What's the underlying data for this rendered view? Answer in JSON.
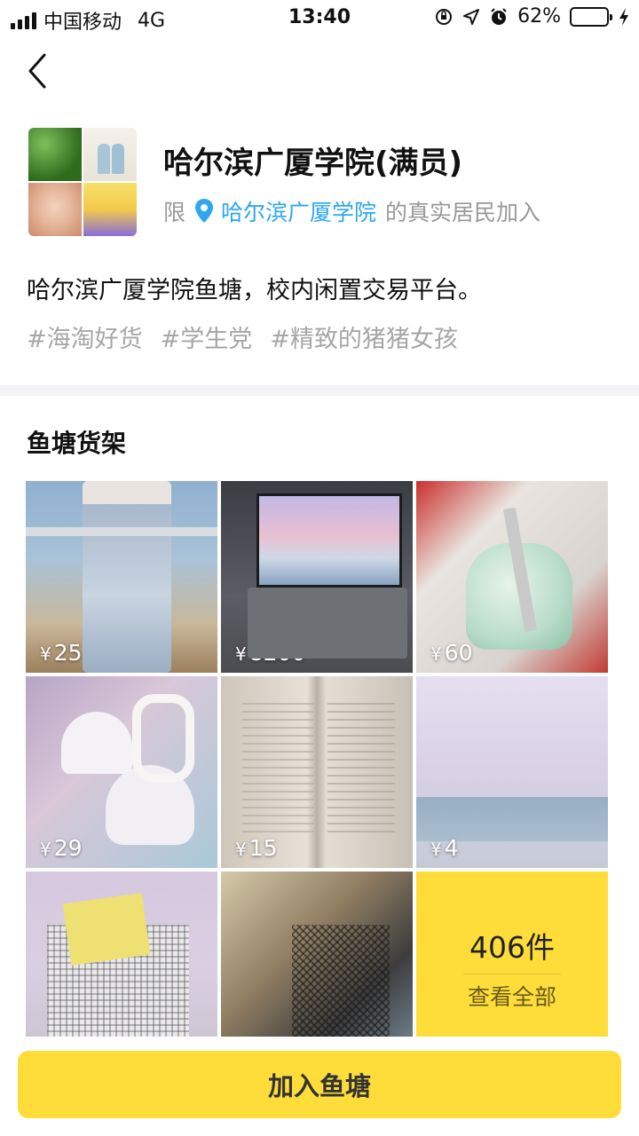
{
  "status_bar": {
    "carrier": "中国移动",
    "network": "4G",
    "time": "13:40",
    "battery_percent": "62%",
    "battery_level": 0.62,
    "icons": [
      "signal-icon",
      "orientation-lock-icon",
      "location-arrow-icon",
      "alarm-icon",
      "battery-icon",
      "charging-icon"
    ]
  },
  "nav": {
    "back_icon": "chevron-left-icon"
  },
  "pond": {
    "name": "哈尔滨广厦学院(满员)",
    "limit_prefix": "限",
    "limit_place": "哈尔滨广厦学院",
    "limit_suffix": "的真实居民加入",
    "description": "哈尔滨广厦学院鱼塘，校内闲置交易平台。",
    "tags": [
      "#海淘好货",
      "#学生党",
      "#精致的猪猪女孩"
    ]
  },
  "shelf": {
    "title": "鱼塘货架",
    "currency": "¥",
    "items": [
      {
        "price": "25",
        "image": "jeans"
      },
      {
        "price": "8200",
        "image": "laptop"
      },
      {
        "price": "60",
        "image": "heels"
      },
      {
        "price": "29",
        "image": "lamp"
      },
      {
        "price": "15",
        "image": "book"
      },
      {
        "price": "4",
        "image": "bed-net"
      },
      {
        "price": "",
        "image": "basket"
      },
      {
        "price": "",
        "image": "anime-bag"
      }
    ],
    "view_all_count": "406件",
    "view_all_label": "查看全部"
  },
  "actions": {
    "join_label": "加入鱼塘"
  },
  "colors": {
    "accent": "#fedd3a",
    "link": "#2ea7f0",
    "tag": "#a6a6a6"
  }
}
